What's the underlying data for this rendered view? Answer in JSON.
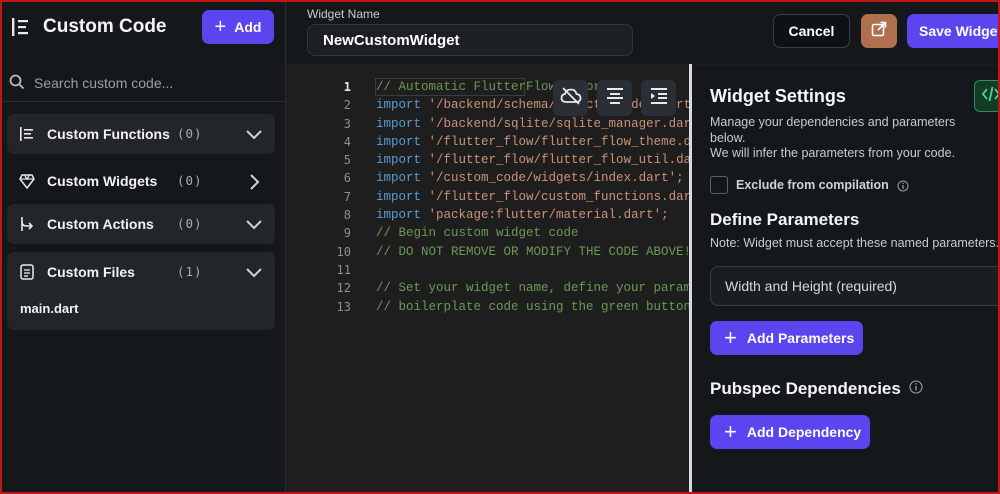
{
  "sidebar": {
    "title": "Custom Code",
    "add_label": "Add",
    "search_placeholder": "Search custom code...",
    "groups": [
      {
        "label": "Custom Functions",
        "count": "(0)",
        "chevron": "chevron-down-icon"
      },
      {
        "label": "Custom Widgets",
        "count": "(0)",
        "chevron": "chevron-right-icon"
      },
      {
        "label": "Custom Actions",
        "count": "(0)",
        "chevron": "chevron-down-icon"
      },
      {
        "label": "Custom Files",
        "count": "(1)",
        "chevron": "chevron-down-icon",
        "files": [
          "main.dart"
        ]
      }
    ]
  },
  "topbar": {
    "widget_name_label": "Widget Name",
    "widget_name_value": "NewCustomWidget",
    "cancel_label": "Cancel",
    "save_label": "Save Widget"
  },
  "editor": {
    "line_numbers": [
      "1",
      "2",
      "3",
      "4",
      "5",
      "6",
      "7",
      "8",
      "9",
      "10",
      "11",
      "12",
      "13"
    ],
    "active_line": 1,
    "lines": [
      [
        {
          "t": "// Automatic FlutterFlow imports",
          "c": "cm"
        }
      ],
      [
        {
          "t": "import",
          "c": "kw"
        },
        {
          "t": " ",
          "c": ""
        },
        {
          "t": "'/backend/schema/structs/index.dart';",
          "c": "str"
        }
      ],
      [
        {
          "t": "import",
          "c": "kw"
        },
        {
          "t": " ",
          "c": ""
        },
        {
          "t": "'/backend/sqlite/sqlite_manager.dart';",
          "c": "str"
        }
      ],
      [
        {
          "t": "import",
          "c": "kw"
        },
        {
          "t": " ",
          "c": ""
        },
        {
          "t": "'/flutter_flow/flutter_flow_theme.dart';",
          "c": "str"
        }
      ],
      [
        {
          "t": "import",
          "c": "kw"
        },
        {
          "t": " ",
          "c": ""
        },
        {
          "t": "'/flutter_flow/flutter_flow_util.dart';",
          "c": "str"
        }
      ],
      [
        {
          "t": "import",
          "c": "kw"
        },
        {
          "t": " ",
          "c": ""
        },
        {
          "t": "'/custom_code/widgets/index.dart';",
          "c": "str"
        }
      ],
      [
        {
          "t": "import",
          "c": "kw"
        },
        {
          "t": " ",
          "c": ""
        },
        {
          "t": "'/flutter_flow/custom_functions.dart';",
          "c": "str"
        }
      ],
      [
        {
          "t": "import",
          "c": "kw"
        },
        {
          "t": " ",
          "c": ""
        },
        {
          "t": "'package:flutter/material.dart';",
          "c": "str"
        }
      ],
      [
        {
          "t": "// Begin custom widget code",
          "c": "cm"
        }
      ],
      [
        {
          "t": "// DO NOT REMOVE OR MODIFY THE CODE ABOVE!",
          "c": "cm"
        }
      ],
      [],
      [
        {
          "t": "// Set your widget name, define your parameter, and then add the",
          "c": "cm"
        }
      ],
      [
        {
          "t": "// boilerplate code using the green button on the right!",
          "c": "cm"
        }
      ]
    ],
    "tools": [
      "cloud-off-icon",
      "align-center-icon",
      "indent-icon"
    ]
  },
  "panel": {
    "title": "Widget Settings",
    "description_1": "Manage your dependencies and parameters below.",
    "description_2": "We will infer the parameters from your code.",
    "exclude_label": "Exclude from compilation",
    "define_params_title": "Define Parameters",
    "define_params_note": "Note: Widget must accept these named parameters.",
    "param_placeholder": "Width and Height (required)",
    "add_params_label": "Add Parameters",
    "pubspec_title": "Pubspec Dependencies",
    "add_dependency_label": "Add Dependency"
  },
  "colors": {
    "accent": "#5b45ee",
    "open_button": "#b0704d",
    "code_badge": "#2f8f5a"
  }
}
